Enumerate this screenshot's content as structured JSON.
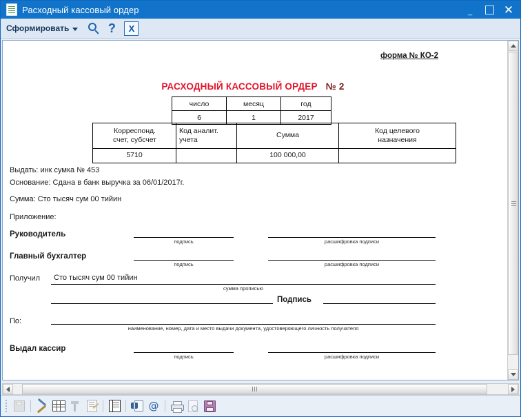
{
  "window": {
    "title": "Расходный кассовый ордер",
    "doc_icon": "document-icon",
    "minimize": "minimize-icon",
    "maximize": "maximize-icon",
    "close": "close-icon"
  },
  "toolbar": {
    "generate_label": "Сформировать",
    "dropdown_icon": "chevron-down-icon",
    "search_icon": "search-icon",
    "help_label": "?",
    "excel_label": "X"
  },
  "document": {
    "form_code": "форма № КО-2",
    "title": "РАСХОДНЫЙ КАССОВЫЙ ОРДЕР",
    "number": "№ 2",
    "date_table": {
      "headers": [
        "число",
        "месяц",
        "год"
      ],
      "values": [
        "6",
        "1",
        "2017"
      ]
    },
    "main_table": {
      "headers": [
        "Корреспонд. счет, субсчет",
        "Код аналит. учета",
        "Сумма",
        "Код целевого назначения"
      ],
      "header_lines": [
        [
          "Корреспонд.",
          "счет, субсчет"
        ],
        [
          "Код аналит.",
          "учета"
        ],
        [
          "Сумма",
          ""
        ],
        [
          "Код целевого",
          "назначения"
        ]
      ],
      "values": [
        "5710",
        "",
        "100 000,00",
        ""
      ],
      "amount_color": "#1a8a3c"
    },
    "issue_to_label": "Выдать:",
    "issue_to_value": "инк сумка № 453",
    "basis_label": "Основание:",
    "basis_value": "Сдана в банк выручка за 06/01/2017г.",
    "sum_label": "Сумма:",
    "sum_value": "Сто тысяч сум 00 тийин",
    "appendix_label": "Приложение:",
    "director_label": "Руководитель",
    "chief_accountant_label": "Главный бухгалтер",
    "signature_caption": "подпись",
    "decoding_caption": "расшифровка подписи",
    "received_label": "Получил",
    "received_value": "Сто тысяч сум 00 тийин",
    "amount_in_words_caption": "сумма прописью",
    "signature_label": "Подпись",
    "by_label": "По:",
    "document_caption": "наименование, номер, дата  и место выдачи документа,  удостоверяющего личность получателя",
    "cashier_label": "Выдал кассир"
  },
  "scrollbars": {
    "v_up": "scroll-up-arrow-icon",
    "v_down": "scroll-down-arrow-icon",
    "h_left": "scroll-left-arrow-icon",
    "h_right": "scroll-right-arrow-icon"
  },
  "bottom_toolbar": {
    "icons": [
      "save-disk-icon",
      "tools-icon",
      "table-properties-icon",
      "sort-icon",
      "edit-document-icon",
      "grid-view-icon",
      "find-in-document-icon",
      "email-icon",
      "print-icon",
      "print-preview-icon",
      "save-icon"
    ]
  },
  "colors": {
    "titlebar": "#1173c9",
    "toolbar": "#dde8f4",
    "title_red": "#e2152b",
    "amount_green": "#1a8a3c"
  }
}
